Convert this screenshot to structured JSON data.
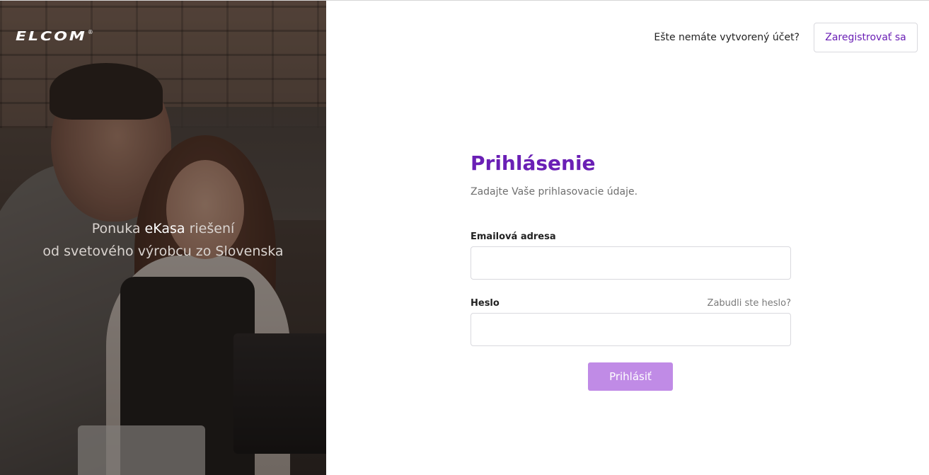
{
  "hero": {
    "logo_text": "ELCOM",
    "logo_mark": "®",
    "tagline_prefix": "Ponuka ",
    "tagline_highlight": "eKasa",
    "tagline_suffix": " riešení",
    "tagline_line2": "od svetového výrobcu zo Slovenska"
  },
  "header": {
    "question": "Ešte nemáte vytvorený účet?",
    "register_label": "Zaregistrovať sa"
  },
  "form": {
    "title": "Prihlásenie",
    "subtitle": "Zadajte Vaše prihlasovacie údaje.",
    "email_label": "Emailová adresa",
    "email_value": "",
    "password_label": "Heslo",
    "password_value": "",
    "forgot_label": "Zabudli ste heslo?",
    "submit_label": "Prihlásiť"
  },
  "colors": {
    "accent": "#6a1fb5",
    "button_bg": "#c08be6",
    "border": "#d9d9de"
  }
}
